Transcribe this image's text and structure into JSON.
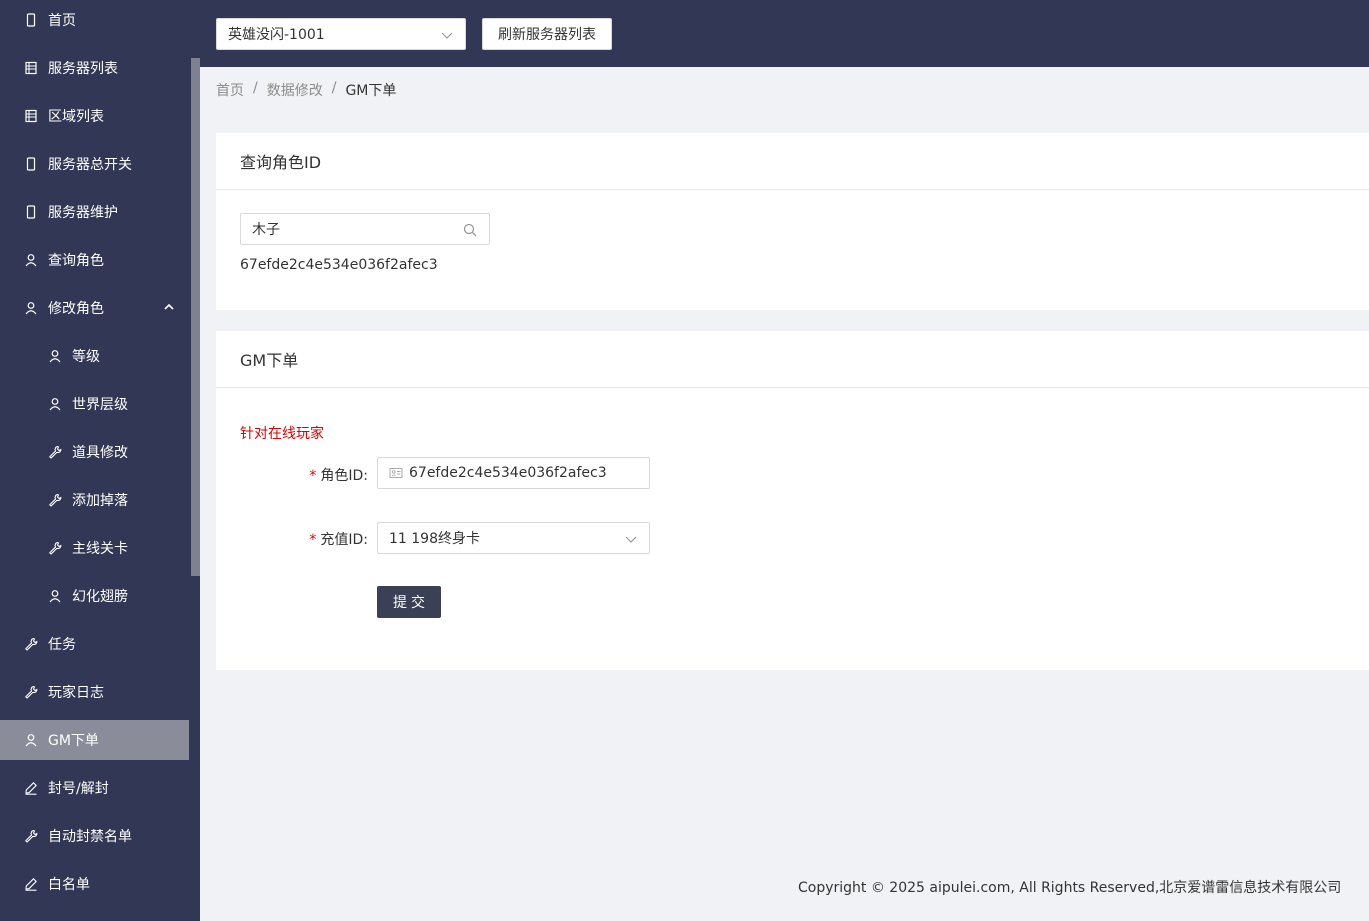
{
  "sidebar": {
    "items": [
      {
        "label": "首页",
        "icon": "mobile-icon"
      },
      {
        "label": "服务器列表",
        "icon": "list-icon"
      },
      {
        "label": "区域列表",
        "icon": "list-icon"
      },
      {
        "label": "服务器总开关",
        "icon": "mobile-icon"
      },
      {
        "label": "服务器维护",
        "icon": "mobile-icon"
      },
      {
        "label": "查询角色",
        "icon": "user-icon"
      },
      {
        "label": "修改角色",
        "icon": "user-icon",
        "expanded": true
      },
      {
        "label": "等级",
        "icon": "user-icon",
        "sub": true
      },
      {
        "label": "世界层级",
        "icon": "user-icon",
        "sub": true
      },
      {
        "label": "道具修改",
        "icon": "wrench-icon",
        "sub": true
      },
      {
        "label": "添加掉落",
        "icon": "wrench-icon",
        "sub": true
      },
      {
        "label": "主线关卡",
        "icon": "wrench-icon",
        "sub": true
      },
      {
        "label": "幻化翅膀",
        "icon": "user-icon",
        "sub": true
      },
      {
        "label": "任务",
        "icon": "wrench-icon"
      },
      {
        "label": "玩家日志",
        "icon": "wrench-icon"
      },
      {
        "label": "GM下单",
        "icon": "user-icon",
        "active": true
      },
      {
        "label": "封号/解封",
        "icon": "edit-icon"
      },
      {
        "label": "自动封禁名单",
        "icon": "wrench-icon"
      },
      {
        "label": "白名单",
        "icon": "edit-icon"
      }
    ]
  },
  "topbar": {
    "server_value": "英雄没闪-1001",
    "refresh_label": "刷新服务器列表"
  },
  "breadcrumb": {
    "home": "首页",
    "section": "数据修改",
    "current": "GM下单"
  },
  "query_card": {
    "title": "查询角色ID",
    "search_value": "木子",
    "result_id": "67efde2c4e534e036f2afec3"
  },
  "order_card": {
    "title": "GM下单",
    "online_label": "针对在线玩家",
    "role_id_label": "角色ID:",
    "role_id_value": "67efde2c4e534e036f2afec3",
    "recharge_label": "充值ID:",
    "recharge_value": "11 198终身卡",
    "submit_label": "提交"
  },
  "footer": {
    "copyright": "Copyright © 2025 aipulei.com, All Rights Reserved,北京爱谱雷信息技术有限公司"
  },
  "colors": {
    "sidebar_bg": "#323755",
    "active_bg": "#8a8d99",
    "required": "#e00000",
    "button_bg": "#3a4157"
  }
}
